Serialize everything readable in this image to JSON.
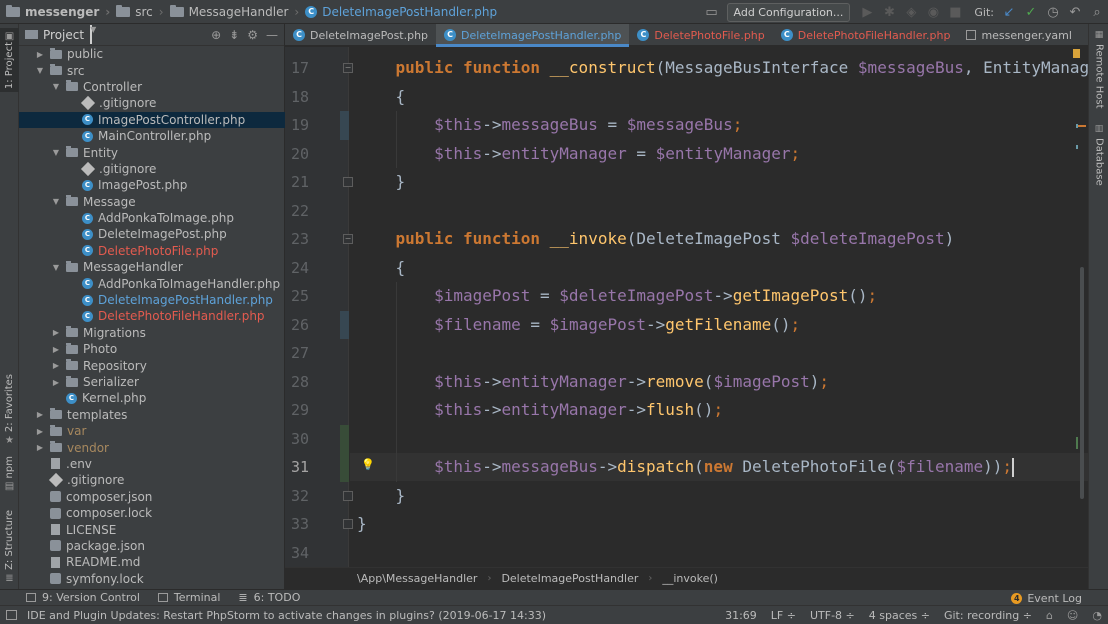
{
  "navbar": {
    "crumbs": [
      "messenger",
      "src",
      "MessageHandler",
      "DeleteImagePostHandler.php"
    ],
    "add_config_label": "Add Configuration...",
    "git_label": "Git:"
  },
  "left_strip": {
    "project_tab": "1: Project",
    "favorites_tab": "2: Favorites",
    "npm_tab": "npm",
    "structure_tab": "Z: Structure"
  },
  "right_strip": {
    "remote_host_tab": "Remote Host",
    "database_tab": "Database"
  },
  "project_panel": {
    "title": "Project",
    "tree": [
      {
        "label": "public",
        "type": "folder",
        "depth": 1,
        "expanded": false
      },
      {
        "label": "src",
        "type": "folder",
        "depth": 1,
        "expanded": true
      },
      {
        "label": "Controller",
        "type": "folder",
        "depth": 2,
        "expanded": true
      },
      {
        "label": ".gitignore",
        "type": "git",
        "depth": 3
      },
      {
        "label": "ImagePostController.php",
        "type": "php",
        "depth": 3,
        "selected": true
      },
      {
        "label": "MainController.php",
        "type": "php",
        "depth": 3
      },
      {
        "label": "Entity",
        "type": "folder",
        "depth": 2,
        "expanded": true
      },
      {
        "label": ".gitignore",
        "type": "git",
        "depth": 3
      },
      {
        "label": "ImagePost.php",
        "type": "php",
        "depth": 3
      },
      {
        "label": "Message",
        "type": "folder",
        "depth": 2,
        "expanded": true
      },
      {
        "label": "AddPonkaToImage.php",
        "type": "php",
        "depth": 3
      },
      {
        "label": "DeleteImagePost.php",
        "type": "php",
        "depth": 3
      },
      {
        "label": "DeletePhotoFile.php",
        "type": "php",
        "depth": 3,
        "status": "red"
      },
      {
        "label": "MessageHandler",
        "type": "folder",
        "depth": 2,
        "expanded": true
      },
      {
        "label": "AddPonkaToImageHandler.php",
        "type": "php",
        "depth": 3
      },
      {
        "label": "DeleteImagePostHandler.php",
        "type": "php",
        "depth": 3,
        "status": "blue"
      },
      {
        "label": "DeletePhotoFileHandler.php",
        "type": "php",
        "depth": 3,
        "status": "red"
      },
      {
        "label": "Migrations",
        "type": "folder",
        "depth": 2,
        "expanded": false
      },
      {
        "label": "Photo",
        "type": "folder",
        "depth": 2,
        "expanded": false
      },
      {
        "label": "Repository",
        "type": "folder",
        "depth": 2,
        "expanded": false
      },
      {
        "label": "Serializer",
        "type": "folder",
        "depth": 2,
        "expanded": false
      },
      {
        "label": "Kernel.php",
        "type": "php",
        "depth": 2
      },
      {
        "label": "templates",
        "type": "folder",
        "depth": 1,
        "expanded": false
      },
      {
        "label": "var",
        "type": "folder",
        "depth": 1,
        "expanded": false,
        "status": "brown"
      },
      {
        "label": "vendor",
        "type": "folder",
        "depth": 1,
        "expanded": false,
        "status": "brown"
      },
      {
        "label": ".env",
        "type": "plain",
        "depth": 1
      },
      {
        "label": ".gitignore",
        "type": "git",
        "depth": 1
      },
      {
        "label": "composer.json",
        "type": "json",
        "depth": 1
      },
      {
        "label": "composer.lock",
        "type": "json",
        "depth": 1
      },
      {
        "label": "LICENSE",
        "type": "plain",
        "depth": 1
      },
      {
        "label": "package.json",
        "type": "json",
        "depth": 1
      },
      {
        "label": "README.md",
        "type": "plain",
        "depth": 1
      },
      {
        "label": "symfony.lock",
        "type": "json",
        "depth": 1
      }
    ]
  },
  "tabs": [
    {
      "label": "DeleteImagePost.php",
      "icon": "php",
      "state": "normal"
    },
    {
      "label": "DeleteImagePostHandler.php",
      "icon": "php",
      "state": "active"
    },
    {
      "label": "DeletePhotoFile.php",
      "icon": "php",
      "state": "red"
    },
    {
      "label": "DeletePhotoFileHandler.php",
      "icon": "php",
      "state": "red"
    },
    {
      "label": "messenger.yaml",
      "icon": "yaml",
      "state": "normal"
    }
  ],
  "editor": {
    "line_numbers": [
      "17",
      "18",
      "19",
      "20",
      "21",
      "22",
      "23",
      "24",
      "25",
      "26",
      "27",
      "28",
      "29",
      "30",
      "31",
      "32",
      "33",
      "34"
    ],
    "current_line": "31",
    "lines": [
      [
        [
          "kw",
          "    public function "
        ],
        [
          "fn",
          "__construct"
        ],
        [
          "cls",
          "(MessageBusInterface "
        ],
        [
          "var",
          "$messageBus"
        ],
        [
          "cls",
          ", EntityManage"
        ]
      ],
      [
        [
          "cls",
          "    {"
        ]
      ],
      [
        [
          "var",
          "        $this"
        ],
        [
          "cls",
          "->"
        ],
        [
          "var",
          "messageBus"
        ],
        [
          "cls",
          " = "
        ],
        [
          "var",
          "$messageBus"
        ],
        [
          "kw2",
          ";"
        ]
      ],
      [
        [
          "var",
          "        $this"
        ],
        [
          "cls",
          "->"
        ],
        [
          "var",
          "entityManager"
        ],
        [
          "cls",
          " = "
        ],
        [
          "var",
          "$entityManager"
        ],
        [
          "kw2",
          ";"
        ]
      ],
      [
        [
          "cls",
          "    }"
        ]
      ],
      [
        [
          "cls",
          ""
        ]
      ],
      [
        [
          "kw",
          "    public function "
        ],
        [
          "fn",
          "__invoke"
        ],
        [
          "cls",
          "(DeleteImagePost "
        ],
        [
          "var",
          "$deleteImagePost"
        ],
        [
          "cls",
          ")"
        ]
      ],
      [
        [
          "cls",
          "    {"
        ]
      ],
      [
        [
          "var",
          "        $imagePost"
        ],
        [
          "cls",
          " = "
        ],
        [
          "var",
          "$deleteImagePost"
        ],
        [
          "cls",
          "->"
        ],
        [
          "fn",
          "getImagePost"
        ],
        [
          "cls",
          "()"
        ],
        [
          "kw2",
          ";"
        ]
      ],
      [
        [
          "var",
          "        $filename"
        ],
        [
          "cls",
          " = "
        ],
        [
          "var",
          "$imagePost"
        ],
        [
          "cls",
          "->"
        ],
        [
          "fn",
          "getFilename"
        ],
        [
          "cls",
          "()"
        ],
        [
          "kw2",
          ";"
        ]
      ],
      [
        [
          "cls",
          ""
        ]
      ],
      [
        [
          "var",
          "        $this"
        ],
        [
          "cls",
          "->"
        ],
        [
          "var",
          "entityManager"
        ],
        [
          "cls",
          "->"
        ],
        [
          "fn",
          "remove"
        ],
        [
          "cls",
          "("
        ],
        [
          "var",
          "$imagePost"
        ],
        [
          "cls",
          ")"
        ],
        [
          "kw2",
          ";"
        ]
      ],
      [
        [
          "var",
          "        $this"
        ],
        [
          "cls",
          "->"
        ],
        [
          "var",
          "entityManager"
        ],
        [
          "cls",
          "->"
        ],
        [
          "fn",
          "flush"
        ],
        [
          "cls",
          "()"
        ],
        [
          "kw2",
          ";"
        ]
      ],
      [
        [
          "cls",
          ""
        ]
      ],
      [
        [
          "var",
          "        $this"
        ],
        [
          "cls",
          "->"
        ],
        [
          "var",
          "messageBus"
        ],
        [
          "cls",
          "->"
        ],
        [
          "fn",
          "dispatch"
        ],
        [
          "cls",
          "("
        ],
        [
          "kw",
          "new "
        ],
        [
          "cls",
          "DeletePhotoFile("
        ],
        [
          "var",
          "$filename"
        ],
        [
          "cls",
          "))"
        ],
        [
          "kw2",
          ";"
        ]
      ],
      [
        [
          "cls",
          "    }"
        ]
      ],
      [
        [
          "cls",
          "}"
        ]
      ],
      [
        [
          "cls",
          ""
        ]
      ]
    ]
  },
  "breadcrumb_bar": [
    "\\App\\MessageHandler",
    "DeleteImagePostHandler",
    "__invoke()"
  ],
  "tool_windows": [
    {
      "label": "9: Version Control"
    },
    {
      "label": "Terminal"
    },
    {
      "label": "6: TODO"
    }
  ],
  "event_log": {
    "label": "Event Log",
    "count": "4"
  },
  "status": {
    "message": "IDE and Plugin Updates: Restart PhpStorm to activate changes in plugins? (2019-06-17 14:33)",
    "position": "31:69",
    "line_sep": "LF ÷",
    "encoding": "UTF-8 ÷",
    "indent": "4 spaces ÷",
    "git_branch": "Git: recording ÷"
  },
  "colors": {
    "accent": "#4a88c7",
    "keyword": "#cc7832",
    "function": "#ffc66d",
    "variable": "#9876aa",
    "modified_file": "#5ea2d9",
    "unversioned_file": "#e35b4f"
  }
}
